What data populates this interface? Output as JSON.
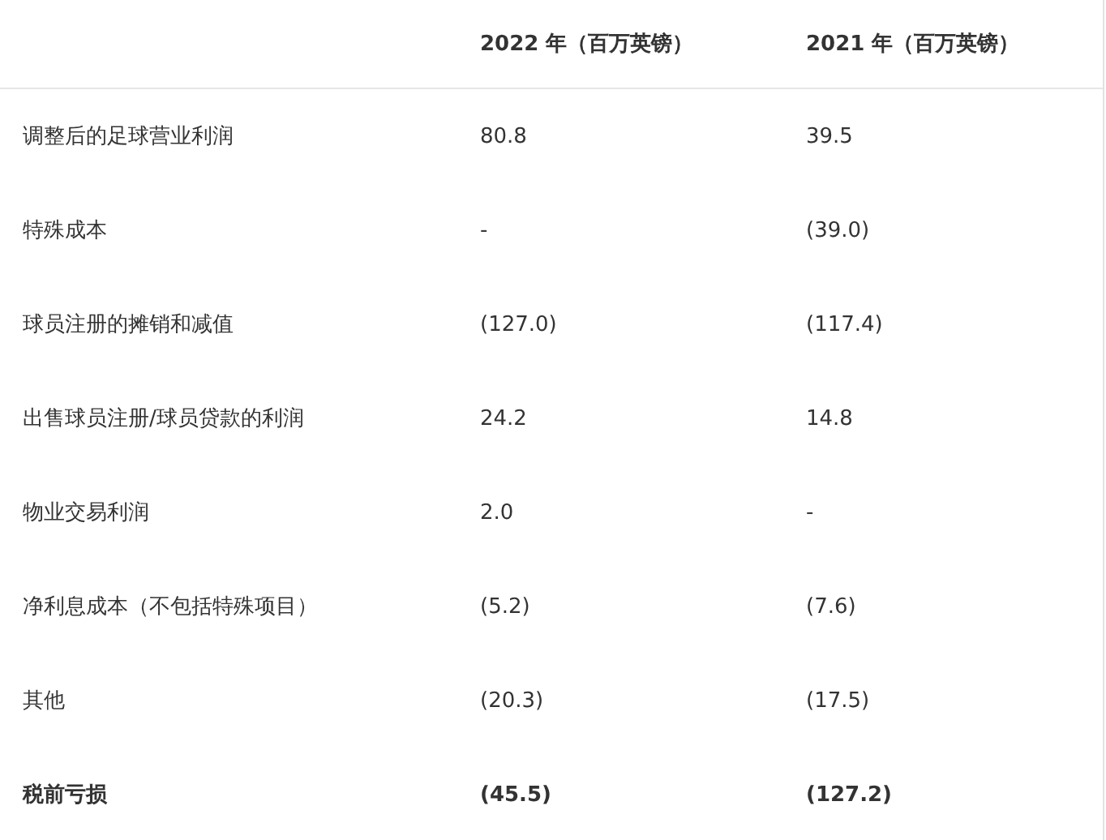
{
  "table": {
    "columns": [
      "",
      "2022 年（百万英镑）",
      "2021 年（百万英镑）"
    ],
    "rows": [
      {
        "kind": "normal",
        "cells": [
          "调整后的足球营业利润",
          "80.8",
          "39.5"
        ]
      },
      {
        "kind": "normal",
        "cells": [
          "特殊成本",
          "-",
          "(39.0)"
        ]
      },
      {
        "kind": "normal",
        "cells": [
          "球员注册的摊销和减值",
          "(127.0)",
          "(117.4)"
        ]
      },
      {
        "kind": "normal",
        "cells": [
          "出售球员注册/球员贷款的利润",
          "24.2",
          "14.8"
        ]
      },
      {
        "kind": "normal",
        "cells": [
          "物业交易利润",
          "2.0",
          "-"
        ]
      },
      {
        "kind": "normal",
        "cells": [
          "净利息成本（不包括特殊项目）",
          "(5.2)",
          "(7.6)"
        ]
      },
      {
        "kind": "normal",
        "cells": [
          "其他",
          "(20.3)",
          "(17.5)"
        ]
      },
      {
        "kind": "total",
        "cells": [
          "税前亏损",
          "(45.5)",
          "(127.2)"
        ]
      }
    ]
  }
}
